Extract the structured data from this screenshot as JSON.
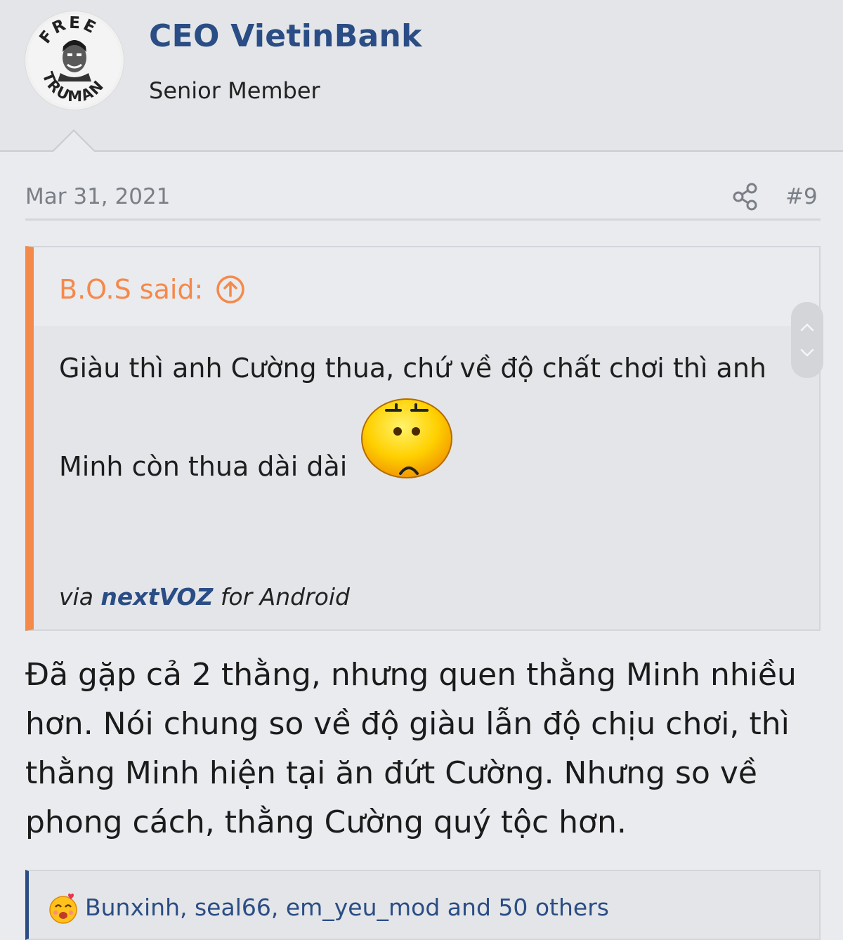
{
  "author": {
    "name": "CEO VietinBank",
    "title": "Senior Member",
    "avatar": {
      "top_text": "FREE",
      "bottom_text": "TRUMAN"
    }
  },
  "post": {
    "date": "Mar 31, 2021",
    "number": "#9",
    "quote": {
      "author_label": "B.O.S said:",
      "line1": "Giàu thì anh Cường thua, chứ về độ chất chơi thì anh",
      "line2": "Minh còn thua dài dài",
      "via_prefix": "via",
      "via_app": "nextVOZ",
      "via_suffix": "for Android"
    },
    "body_lines": [
      "Đã gặp cả 2 thằng, nhưng quen thằng Minh nhiều",
      "hơn. Nói chung so về độ giàu lẫn độ chịu chơi, thì",
      "thằng Minh hiện tại ăn đứt Cường. Nhưng so về",
      "phong cách, thằng Cường quý tộc hơn."
    ],
    "reactions": {
      "text": "Bunxinh, seal66, em_yeu_mod and 50 others",
      "icon": "love-face-icon"
    }
  },
  "colors": {
    "accent": "#2a4d85",
    "quote_border": "#f5894a",
    "muted": "#7a7e86",
    "background": "#e9ebee"
  },
  "icons": [
    "share-icon",
    "arrow-up-circle-icon",
    "annoyed-face-emoji",
    "chevron-up-icon",
    "chevron-down-icon"
  ]
}
